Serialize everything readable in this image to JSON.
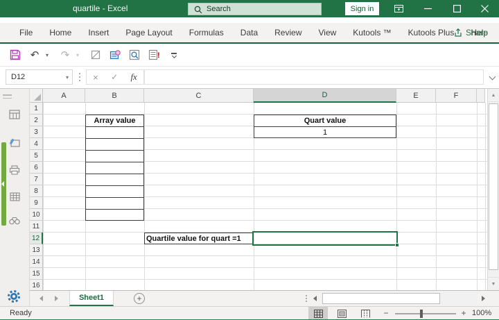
{
  "window": {
    "title": "quartile - Excel",
    "search_label": "Search",
    "sign_in_label": "Sign in"
  },
  "menu": {
    "tabs": [
      "File",
      "Home",
      "Insert",
      "Page Layout",
      "Formulas",
      "Data",
      "Review",
      "View",
      "Kutools ™",
      "Kutools Plus",
      "Help"
    ],
    "share_label": "Share"
  },
  "formula_bar": {
    "cell_reference": "D12",
    "fx_label": "fx",
    "formula_value": ""
  },
  "sheet": {
    "column_headers": [
      "A",
      "B",
      "C",
      "D",
      "E",
      "F"
    ],
    "row_numbers": [
      "1",
      "2",
      "3",
      "4",
      "5",
      "6",
      "7",
      "8",
      "9",
      "10",
      "11",
      "12",
      "13",
      "14",
      "15",
      "16"
    ],
    "selected_column": "D",
    "selected_row": "12",
    "selected_cell": "D12",
    "cells": [
      {
        "ref": "B2",
        "text": "Array value",
        "bold": true,
        "align": "center"
      },
      {
        "ref": "D2",
        "text": "Quart value",
        "bold": true,
        "align": "center"
      },
      {
        "ref": "D3",
        "text": "1",
        "bold": false,
        "align": "center"
      },
      {
        "ref": "C12",
        "text": "Quartile value for quart =1",
        "bold": true,
        "align": "left"
      }
    ],
    "bordered_ranges": [
      "B2:B10",
      "D2:D3",
      "C12"
    ]
  },
  "sheet_tabs": {
    "active_tab": "Sheet1",
    "add_sheet_label": "+"
  },
  "status_bar": {
    "mode": "Ready",
    "zoom_level": "100%"
  },
  "colors": {
    "excel_green": "#217346",
    "selection_border": "#217346",
    "kutools_bar_green": "#73a93f",
    "save_icon_magenta": "#b13eb1"
  }
}
